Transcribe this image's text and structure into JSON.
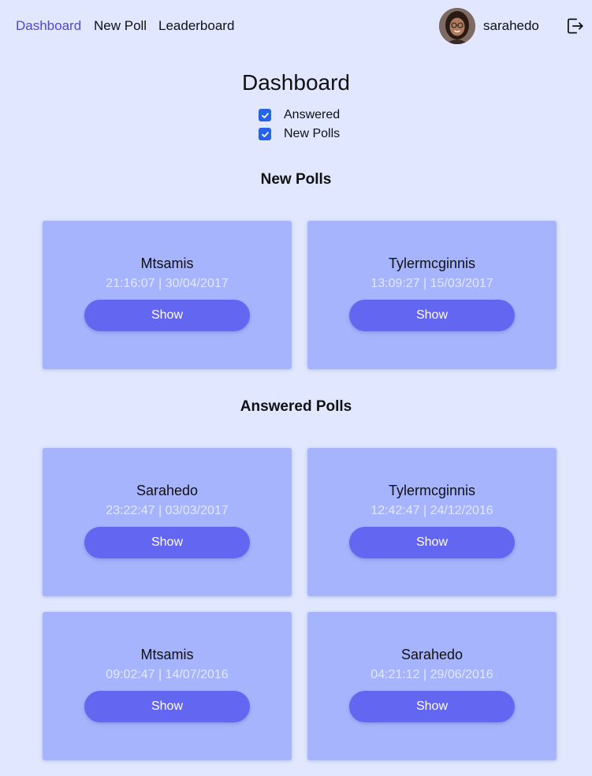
{
  "nav": {
    "dashboard": "Dashboard",
    "new_poll": "New Poll",
    "leaderboard": "Leaderboard",
    "active_color": "#4f46e5"
  },
  "user": {
    "name": "sarahedo",
    "logout_icon": "logout-icon"
  },
  "page": {
    "title": "Dashboard"
  },
  "filters": {
    "answered": {
      "label": "Answered",
      "checked": true
    },
    "new_polls": {
      "label": "New Polls",
      "checked": true
    }
  },
  "sections": {
    "new": {
      "title": "New Polls",
      "polls": [
        {
          "author": "Mtsamis",
          "time": "21:16:07 | 30/04/2017",
          "button": "Show"
        },
        {
          "author": "Tylermcginnis",
          "time": "13:09:27 | 15/03/2017",
          "button": "Show"
        }
      ]
    },
    "answered": {
      "title": "Answered Polls",
      "polls": [
        {
          "author": "Sarahedo",
          "time": "23:22:47 | 03/03/2017",
          "button": "Show"
        },
        {
          "author": "Tylermcginnis",
          "time": "12:42:47 | 24/12/2016",
          "button": "Show"
        },
        {
          "author": "Mtsamis",
          "time": "09:02:47 | 14/07/2016",
          "button": "Show"
        },
        {
          "author": "Sarahedo",
          "time": "04:21:12 | 29/06/2016",
          "button": "Show"
        }
      ]
    }
  },
  "colors": {
    "background": "#e0e7ff",
    "card": "#a5b4fc",
    "button": "#6366f1",
    "checkbox": "#2563eb"
  }
}
